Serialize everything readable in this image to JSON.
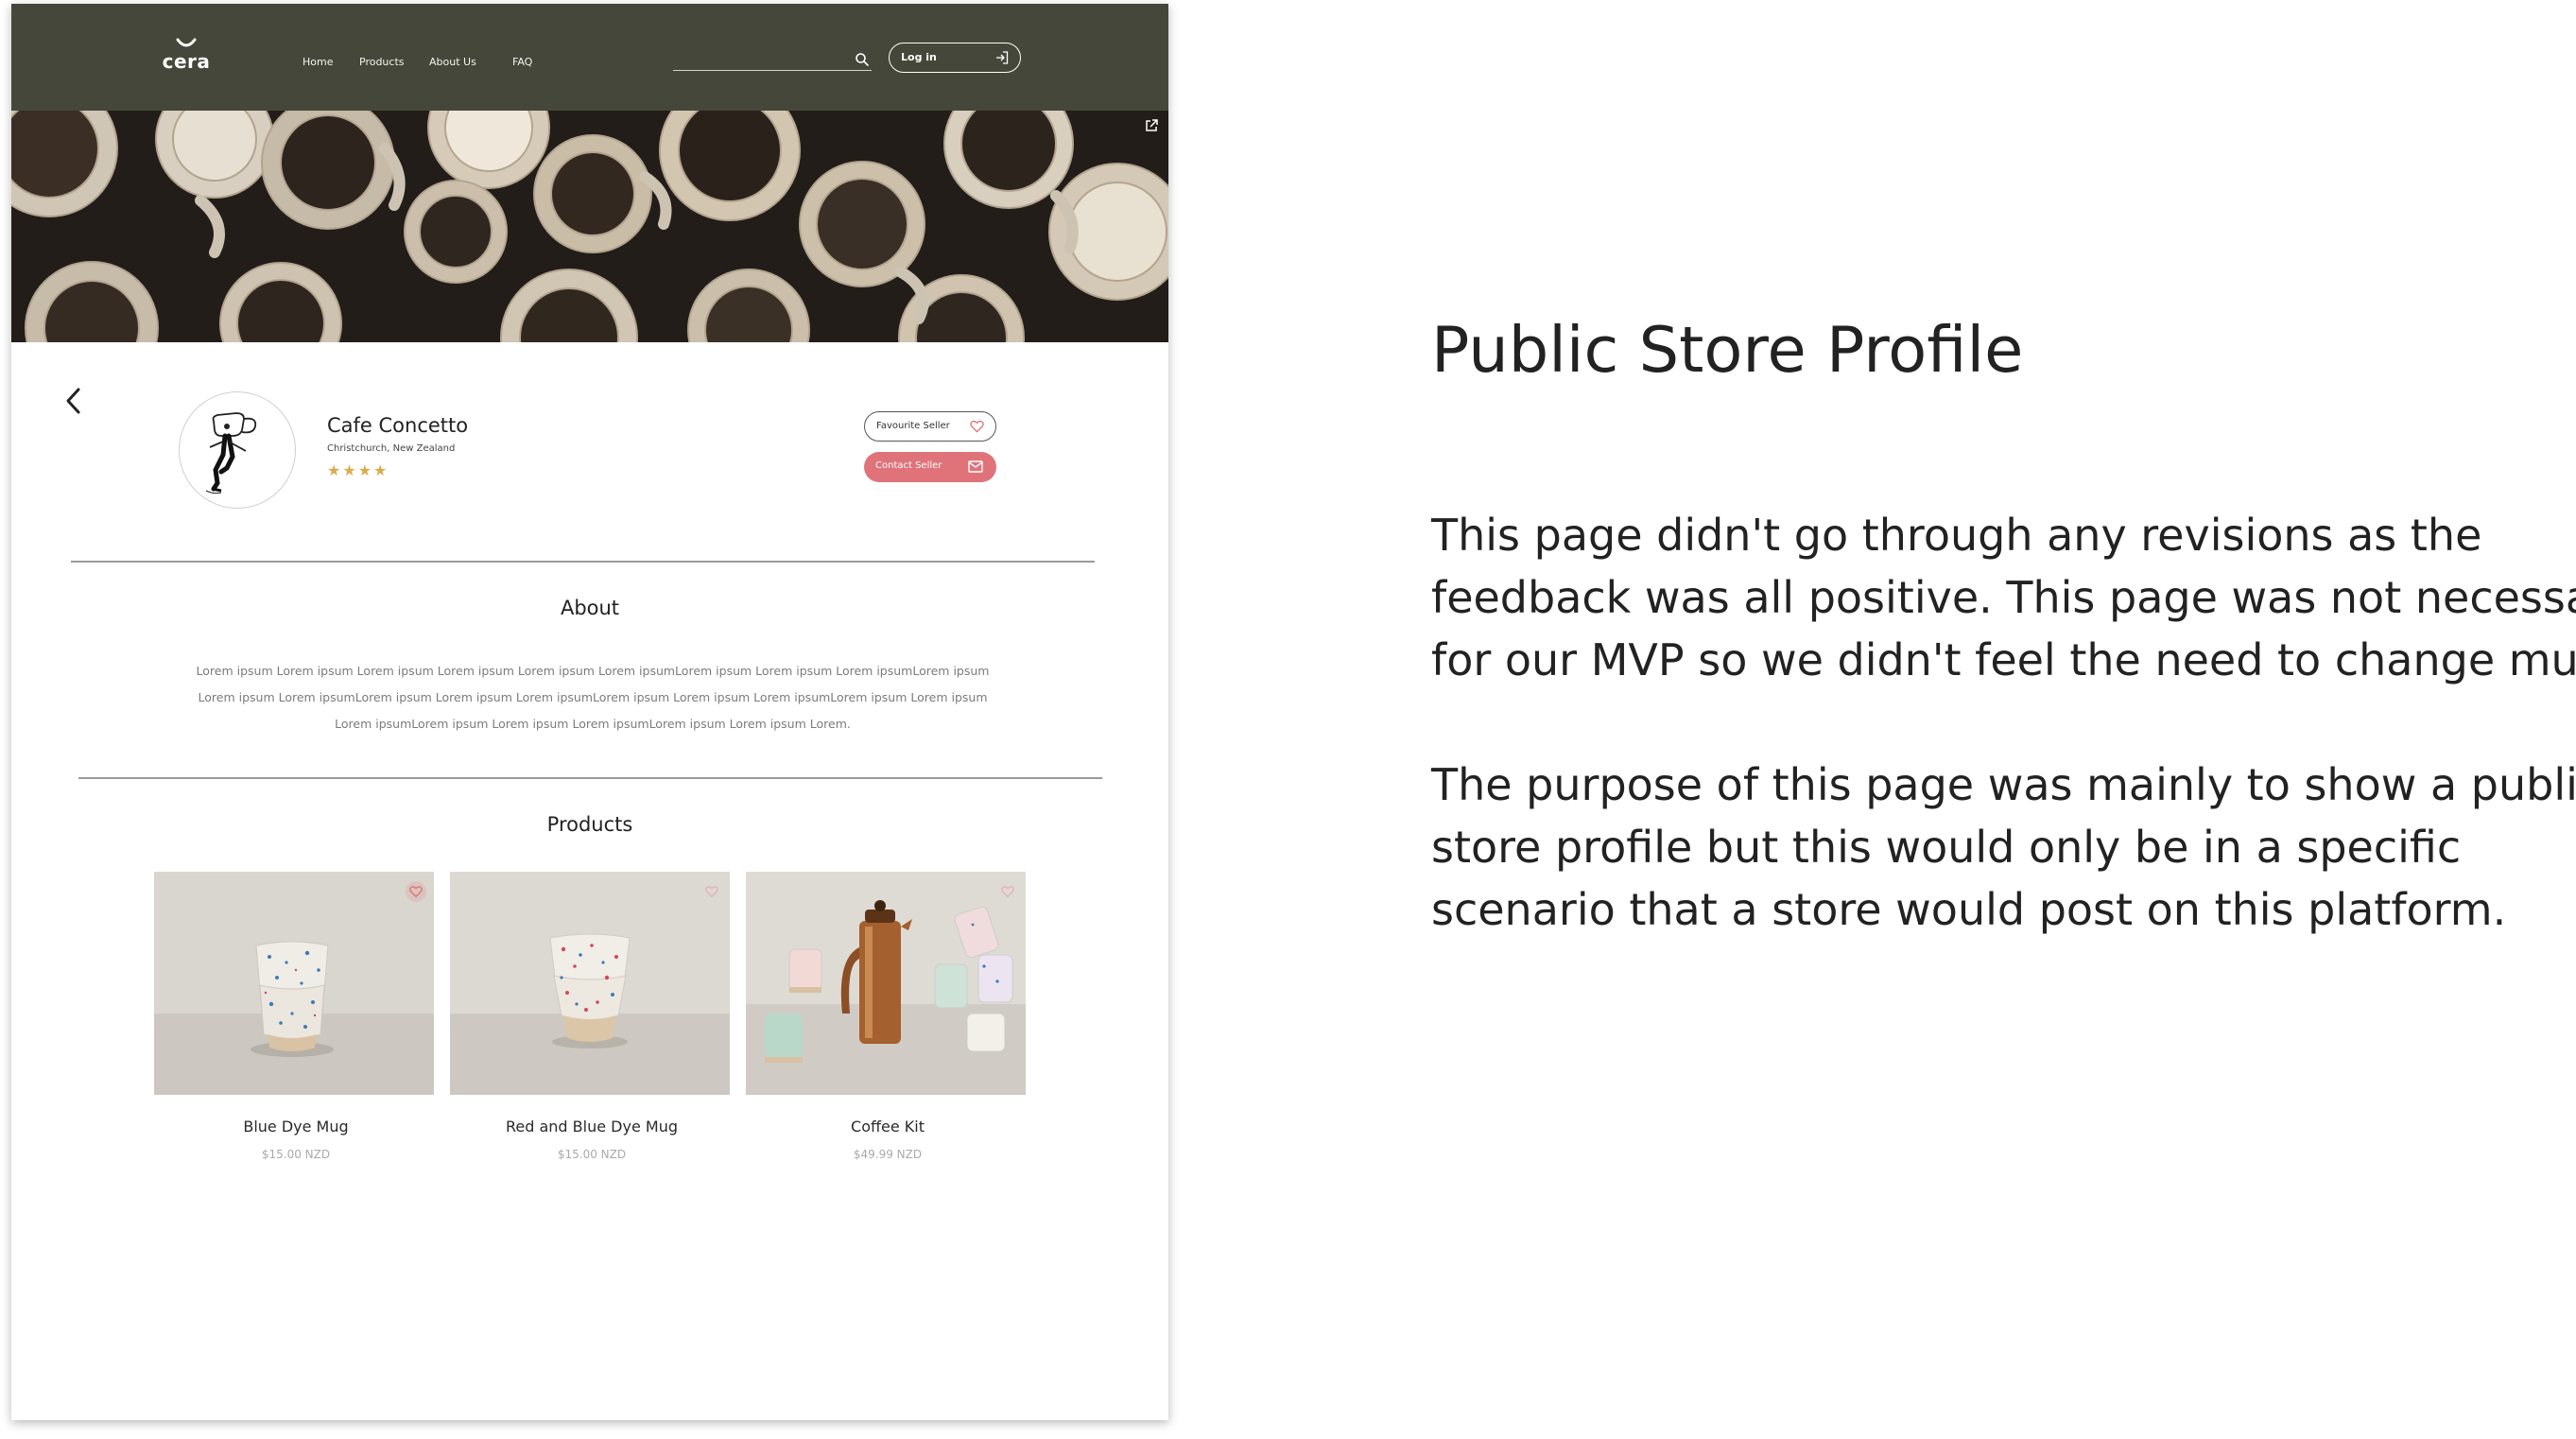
{
  "mockup": {
    "nav": {
      "logo_text": "cera",
      "links": [
        "Home",
        "Products",
        "About Us",
        "FAQ"
      ],
      "search_placeholder": "",
      "login_label": "Log in"
    },
    "profile": {
      "store_name": "Cafe Concetto",
      "location": "Christchurch, New Zealand",
      "rating_stars": "★★★★",
      "rating_value": 4,
      "favourite_button": "Favourite Seller",
      "contact_button": "Contact Seller"
    },
    "about": {
      "heading": "About",
      "body_lines": [
        "Lorem ipsum Lorem ipsum Lorem ipsum Lorem ipsum Lorem ipsum Lorem ipsumLorem ipsum Lorem ipsum Lorem ipsumLorem ipsum",
        "Lorem ipsum Lorem ipsumLorem ipsum Lorem ipsum Lorem ipsumLorem ipsum Lorem ipsum Lorem ipsumLorem ipsum Lorem ipsum",
        "Lorem ipsumLorem ipsum Lorem ipsum Lorem ipsumLorem ipsum Lorem ipsum Lorem."
      ]
    },
    "products": {
      "heading": "Products",
      "items": [
        {
          "name": "Blue Dye Mug",
          "price": "$15.00 NZD"
        },
        {
          "name": "Red and Blue Dye Mug",
          "price": "$15.00 NZD"
        },
        {
          "name": "Coffee Kit",
          "price": "$49.99 NZD"
        }
      ]
    }
  },
  "description": {
    "title": "Public Store Profile",
    "paragraph1": [
      "This page didn't go through any revisions as the",
      "feedback was all positive. This page was not necessary",
      "for our MVP so we didn't feel the need to change much."
    ],
    "paragraph2": [
      "The purpose of this page was mainly to show a public",
      "store profile but this would only be in a specific",
      "scenario that a store would post on this platform."
    ]
  },
  "colors": {
    "navbar": "#45473a",
    "accent": "#e0737a",
    "star": "#d9ad4c"
  },
  "icons": [
    "logo-smile-icon",
    "search-icon",
    "login-arrow-icon",
    "external-link-icon",
    "back-chevron-icon",
    "heart-icon",
    "mail-icon"
  ]
}
